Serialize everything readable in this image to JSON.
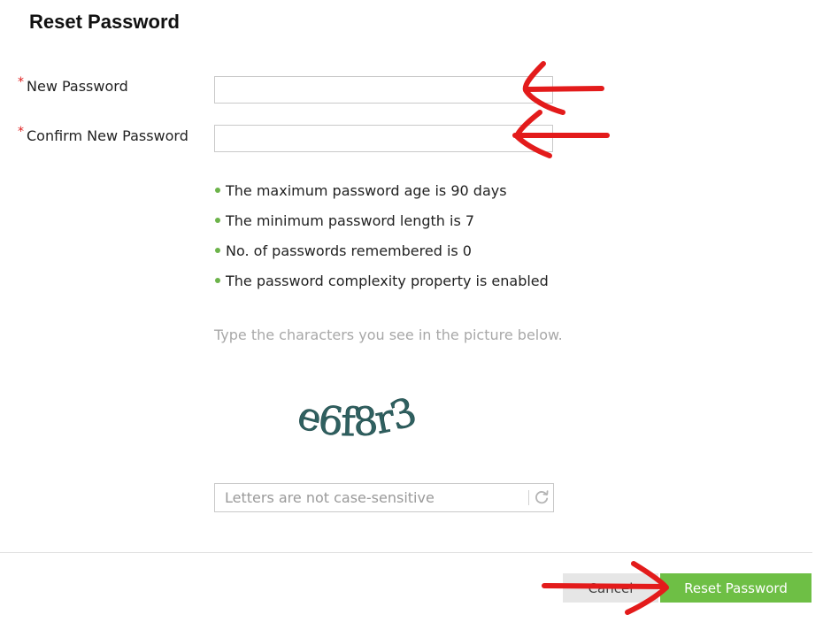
{
  "page": {
    "title": "Reset Password"
  },
  "form": {
    "required_mark": "*",
    "new_password": {
      "label": "New Password",
      "value": ""
    },
    "confirm_password": {
      "label": "Confirm New Password",
      "value": ""
    }
  },
  "policy_rules": [
    "The maximum password age is 90 days",
    "The minimum password length is 7",
    "No. of passwords remembered is 0",
    "The password complexity property is enabled"
  ],
  "captcha": {
    "hint": "Type the characters you see in the picture below.",
    "image_text": "e6f8r3",
    "placeholder": "Letters are not case-sensitive",
    "value": "",
    "refresh_icon": "refresh-icon"
  },
  "actions": {
    "cancel_label": "Cancel",
    "reset_label": "Reset Password"
  },
  "colors": {
    "accent_green": "#6ebf45",
    "bullet_green": "#6cb34a",
    "required_red": "#e02020",
    "annotation_red": "#e31b1b",
    "captcha_text": "#2f6060"
  }
}
